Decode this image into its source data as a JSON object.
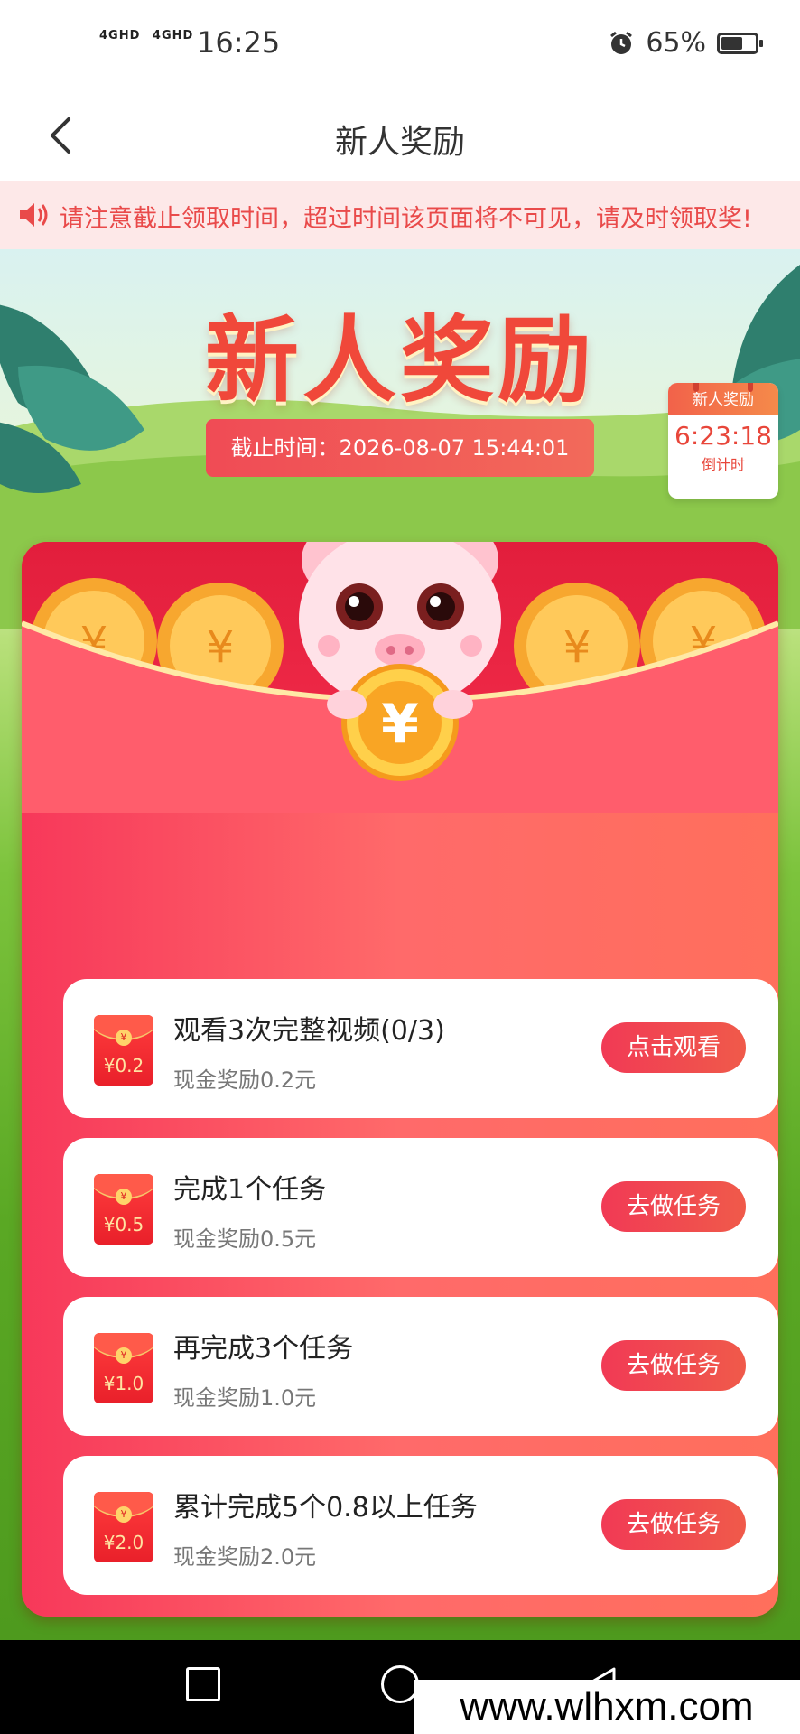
{
  "status_bar": {
    "network1": "4GHD",
    "network2": "4GHD",
    "time": "16:25",
    "battery": "65%",
    "battery_level": 0.65
  },
  "nav": {
    "title": "新人奖励",
    "back_icon": "chevron-left-icon"
  },
  "notice": {
    "icon": "speaker-icon",
    "text": "请注意截止领取时间，超过时间该页面将不可见，请及时领取奖!"
  },
  "hero": {
    "title": "新人奖励",
    "deadline": "截止时间：2026-08-07 15:44:01",
    "calendar": {
      "head": "新人奖励",
      "countdown": "6:23:18",
      "foot": "倒计时"
    }
  },
  "tasks": [
    {
      "icon_amount": "¥0.2",
      "title": "观看3次完整视频(0/3)",
      "reward": "现金奖励0.2元",
      "button": "点击观看"
    },
    {
      "icon_amount": "¥0.5",
      "title": "完成1个任务",
      "reward": "现金奖励0.5元",
      "button": "去做任务"
    },
    {
      "icon_amount": "¥1.0",
      "title": "再完成3个任务",
      "reward": "现金奖励1.0元",
      "button": "去做任务"
    },
    {
      "icon_amount": "¥2.0",
      "title": "累计完成5个0.8以上任务",
      "reward": "现金奖励2.0元",
      "button": "去做任务"
    }
  ],
  "coin_symbol": "¥",
  "seal_symbol": "¥",
  "watermark": "www.wlhxm.com",
  "colors": {
    "accent": "#f13a55",
    "title": "#f0483a",
    "notice_text": "#e94a4a"
  }
}
